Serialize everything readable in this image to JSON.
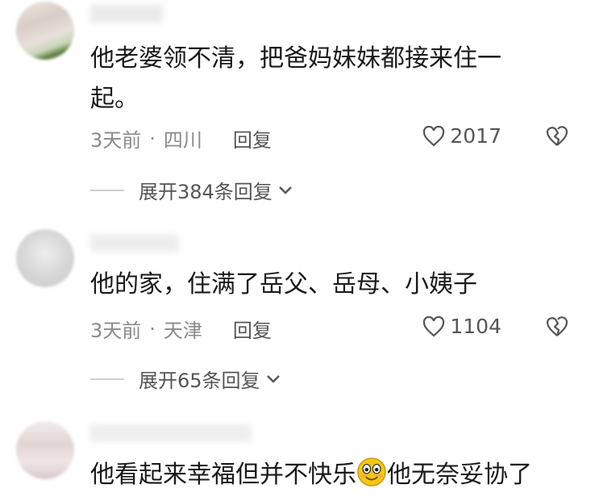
{
  "comments": [
    {
      "text": "他老婆领不清，把爸妈妹妹都接来住一起。",
      "time": "3天前",
      "location": "四川",
      "reply_label": "回复",
      "likes": "2017",
      "expand_label": "展开384条回复"
    },
    {
      "text": "他的家，住满了岳父、岳母、小姨子",
      "time": "3天前",
      "location": "天津",
      "reply_label": "回复",
      "likes": "1104",
      "expand_label": "展开65条回复"
    },
    {
      "text_before": "他看起来幸福但并不快乐",
      "text_after": "他无奈妥协了"
    }
  ],
  "colors": {
    "text": "#1a1a1a",
    "meta": "#8a8a8a",
    "emoji": "#f5c518"
  }
}
